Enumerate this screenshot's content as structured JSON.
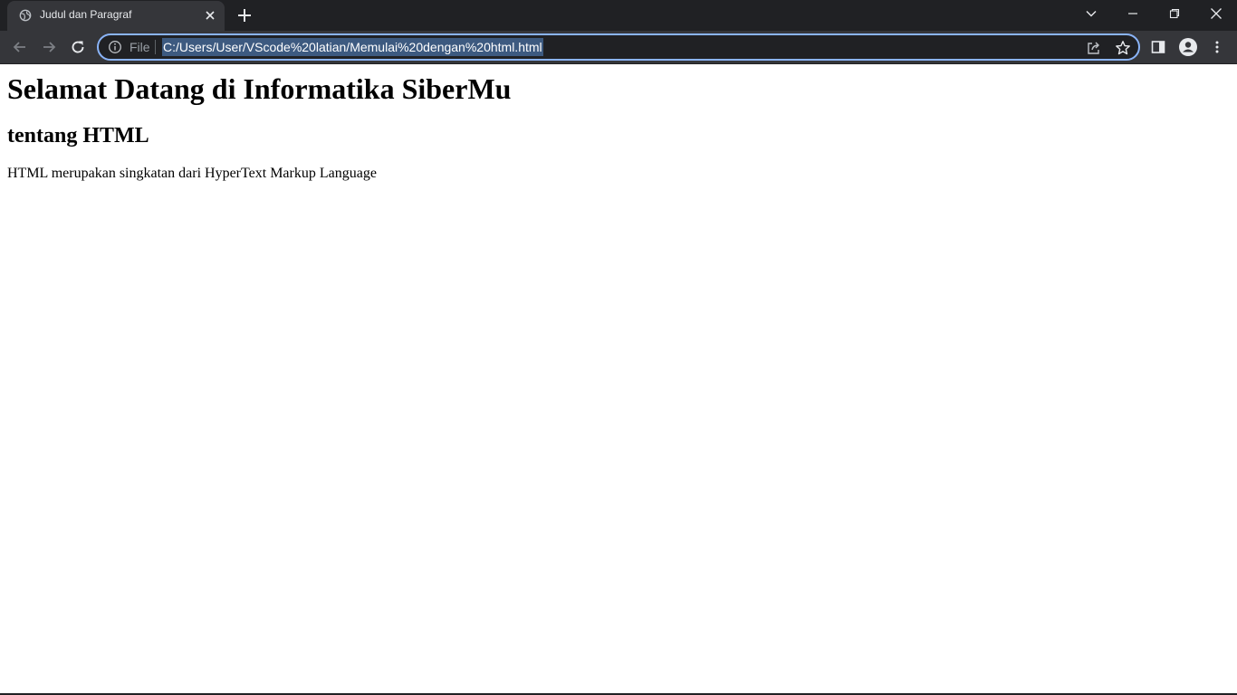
{
  "browser": {
    "tab": {
      "title": "Judul dan Paragraf",
      "favicon": "globe-icon"
    },
    "omnibox": {
      "scheme_label": "File",
      "url": "C:/Users/User/VScode%20latian/Memulai%20dengan%20html.html"
    },
    "icons": {
      "back": "back-arrow-icon",
      "forward": "forward-arrow-icon",
      "reload": "reload-icon",
      "share": "share-icon",
      "bookmark": "star-icon",
      "side_panel": "side-panel-icon",
      "profile": "profile-icon",
      "menu": "kebab-menu-icon"
    },
    "colors": {
      "tabstrip_bg": "#202124",
      "toolbar_bg": "#35363a",
      "omnibox_focus": "#8ab4f8",
      "url_selection": "#3d5a80"
    }
  },
  "page": {
    "heading1": "Selamat Datang di Informatika SiberMu",
    "heading2": "tentang HTML",
    "paragraph": "HTML merupakan singkatan dari HyperText Markup Language"
  }
}
